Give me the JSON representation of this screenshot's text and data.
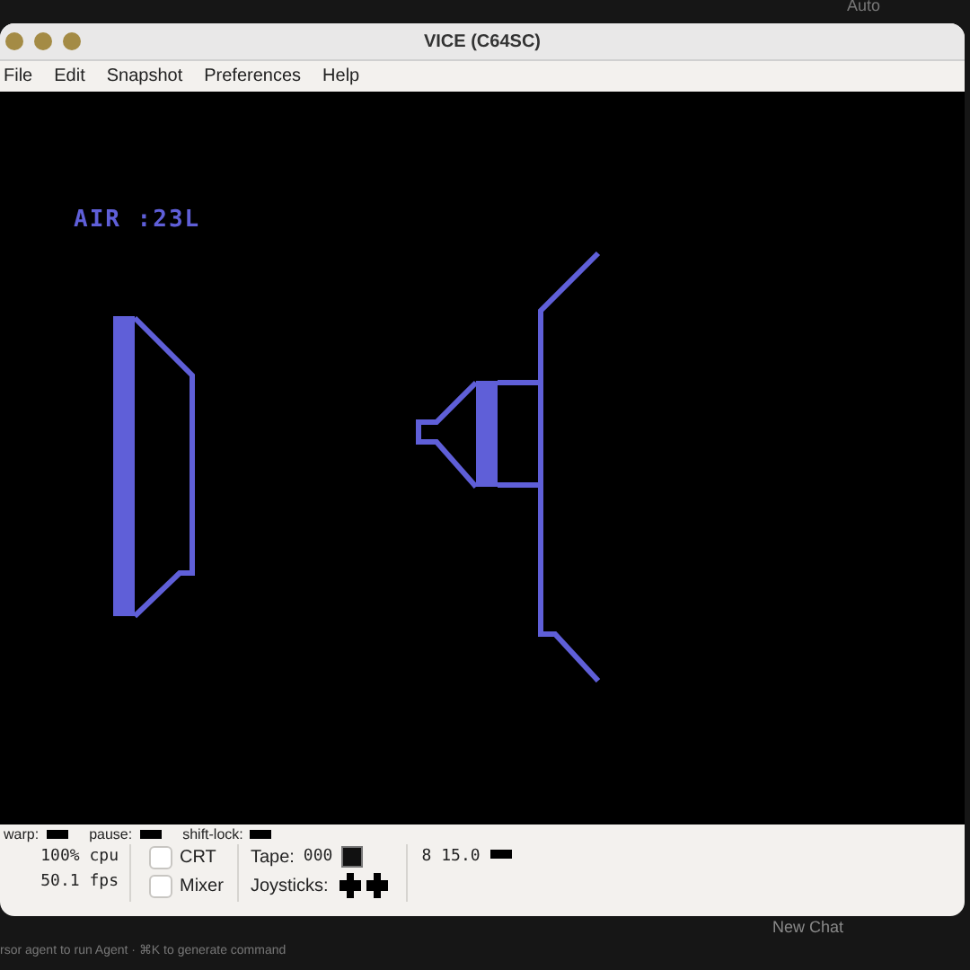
{
  "background": {
    "top_button": "Auto",
    "new_chat": "New Chat",
    "hint": "rsor  agent to run Agent · ⌘K to generate command"
  },
  "window": {
    "title": "VICE (C64SC)"
  },
  "menu": [
    "File",
    "Edit",
    "Snapshot",
    "Preferences",
    "Help"
  ],
  "screen": {
    "hud": "AIR :23L"
  },
  "status_bar": {
    "indicators": [
      {
        "label": "warp:"
      },
      {
        "label": "pause:"
      },
      {
        "label": "shift-lock:"
      }
    ],
    "speed": [
      "100% cpu",
      "50.1 fps"
    ],
    "toggles": [
      {
        "label": "CRT",
        "checked": false
      },
      {
        "label": "Mixer",
        "checked": false
      }
    ],
    "tape_label": "Tape:",
    "tape_counter": "000",
    "joysticks_label": "Joysticks:",
    "drive": "8 15.0"
  }
}
